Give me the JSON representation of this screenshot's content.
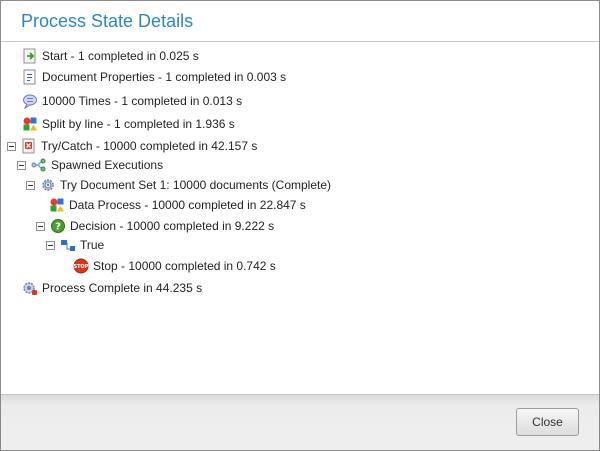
{
  "dialog": {
    "title": "Process State Details",
    "close_label": "Close"
  },
  "tree": {
    "start": "Start - 1 completed in 0.025 s",
    "document_properties": "Document Properties - 1 completed in 0.003 s",
    "times": "10000 Times - 1 completed in 0.013 s",
    "split_by_line": "Split by line - 1 completed in 1.936 s",
    "try_catch": "Try/Catch - 10000 completed in 42.157 s",
    "spawned_executions": "Spawned Executions",
    "try_document_set": "Try Document Set 1: 10000 documents (Complete)",
    "data_process": "Data Process - 10000 completed in 22.847 s",
    "decision": "Decision - 10000 completed in 9.222 s",
    "true_branch": "True",
    "stop": "Stop - 10000 completed in 0.742 s",
    "process_complete": "Process Complete in 44.235 s"
  },
  "icons": {
    "start": "start-icon",
    "document_properties": "document-properties-icon",
    "times": "message-icon",
    "split_by_line": "split-shapes-icon",
    "try_catch": "try-catch-icon",
    "spawned_executions": "branch-icon",
    "try_document_set": "gear-icon",
    "data_process": "data-process-icon",
    "decision": "decision-icon",
    "true_branch": "branch-node-icon",
    "stop": "stop-icon",
    "process_complete": "process-complete-icon"
  },
  "colors": {
    "title": "#2a86c5",
    "stop": "#d9371c",
    "decision": "#4a9e2f"
  }
}
